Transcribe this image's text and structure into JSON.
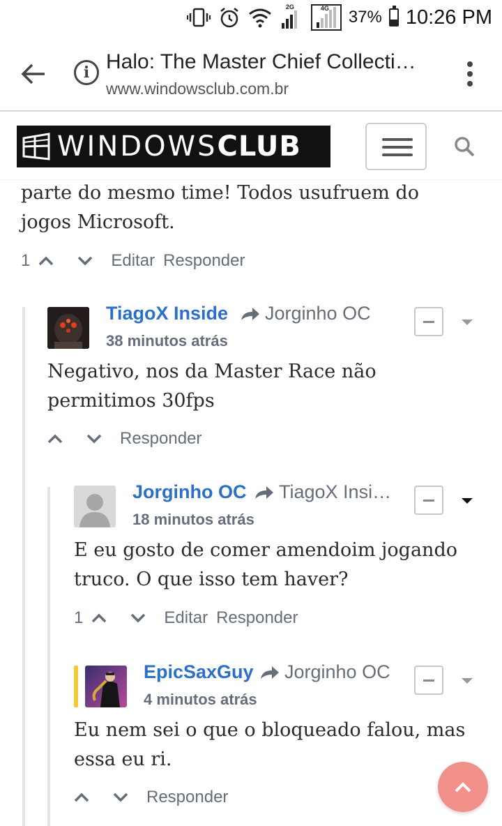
{
  "status_bar": {
    "network_2g": "2G",
    "network_4g": "4G",
    "battery_percent": "37%",
    "battery_level": 0.37,
    "time": "10:26 PM"
  },
  "browser": {
    "page_title": "Halo: The Master Chief Collecti…",
    "host": "www.windowsclub.com.br"
  },
  "site": {
    "logo_text_light": "WINDOWS",
    "logo_text_bold": "CLUB"
  },
  "comments": [
    {
      "text": "parte do mesmo time! Todos usufruem do jogos Microsoft.",
      "vote_count": "1",
      "edit_label": "Editar",
      "reply_label": "Responder"
    },
    {
      "author": "TiagoX Inside",
      "reply_to": "Jorginho OC",
      "time": "38 minutos atrás",
      "text": "Negativo, nos da Master Race não permitimos 30fps",
      "reply_label": "Responder"
    },
    {
      "author": "Jorginho OC",
      "reply_to": "TiagoX Insi…",
      "time": "18 minutos atrás",
      "text": "E eu gosto de comer amendoim jogando truco. O que isso tem haver?",
      "vote_count": "1",
      "edit_label": "Editar",
      "reply_label": "Responder"
    },
    {
      "author": "EpicSaxGuy",
      "reply_to": "Jorginho OC",
      "time": "4 minutos atrás",
      "text": "Eu nem sei o que o bloqueado falou, mas essa eu ri.",
      "reply_label": "Responder"
    }
  ],
  "colors": {
    "author_link": "#2a6fc9",
    "muted": "#656c7a",
    "highlight": "#f2cb3a",
    "fab": "#f0857c"
  }
}
